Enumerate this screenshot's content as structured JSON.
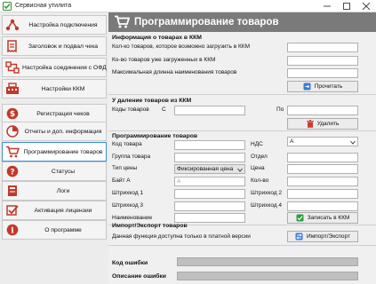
{
  "window": {
    "title": "Сервисная утилита",
    "app_icon": "green-checklist-icon"
  },
  "sidebar": {
    "items": [
      {
        "label": "Настройка подключения",
        "icon": "network-icon",
        "color": "#c0392b"
      },
      {
        "label": "Заголовок и подвал чека",
        "icon": "receipt-icon",
        "color": "#c0392b"
      },
      {
        "label": "Настройка соединения с ОФД",
        "icon": "connection-icon",
        "color": "#c0392b"
      },
      {
        "label": "Настройки ККМ",
        "icon": "register-icon",
        "color": "#c0392b"
      },
      {
        "label": "Регистрация чеков",
        "icon": "dollar-icon",
        "color": "#c0392b"
      },
      {
        "label": "Отчеты и доп. информация",
        "icon": "pie-chart-icon",
        "color": "#c0392b"
      },
      {
        "label": "Программирование товаров",
        "icon": "cart-icon",
        "color": "#c0392b",
        "active": true
      },
      {
        "label": "Статусы",
        "icon": "question-icon",
        "color": "#c0392b"
      },
      {
        "label": "Логи",
        "icon": "log-book-icon",
        "color": "#c0392b"
      },
      {
        "label": "Активация лицензии",
        "icon": "checkbox-icon",
        "color": "#c0392b"
      },
      {
        "label": "О программе",
        "icon": "info-icon",
        "color": "#c0392b"
      }
    ]
  },
  "header": {
    "title": "Программирование товаров",
    "icon": "cart-icon"
  },
  "kkm_info": {
    "section_title": "Информация о товарах в ККМ",
    "can_load_label": "Кол-ко товаров, которое возможно загрузить в ККМ",
    "loaded_label": "Ко-во товаров уже загруженных в ККМ",
    "max_name_label": "Максимальная длинна наименования товаров",
    "read_button": "Прочитать"
  },
  "delete_section": {
    "section_title": "У даление товаров из ККМ",
    "codes_label": "Коды товаров",
    "from_label": "С",
    "to_label": "По",
    "delete_button": "Удалить"
  },
  "program_section": {
    "section_title": "Программирование товаров",
    "code_label": "Код товара",
    "group_label": "Группа товара",
    "price_type_label": "Тип цены",
    "price_type_value": "Фиксированная цена",
    "byte_label": "Байт А",
    "byte_placeholder": "А",
    "barcode1_label": "Штрихкод 1",
    "barcode3_label": "Штрихкод 3",
    "name_label": "Наименование",
    "vat_label": "НДС",
    "vat_value": "А",
    "dept_label": "Отдел",
    "price_label": "Цена",
    "qty_label": "Кол-во",
    "barcode2_label": "Штрихкод 2",
    "barcode4_label": "Штрихкод 4",
    "write_button": "Записать в ККМ"
  },
  "import_export": {
    "section_title": "Импорт/Экспорт товаров",
    "note": "Данная функция доступна только в платной версии",
    "button": "Импорт/Экспорт"
  },
  "errors": {
    "code_label": "Код ошибки",
    "desc_label": "Описание ошибки"
  },
  "colors": {
    "accent_red": "#c0392b",
    "header_grey": "#7a7a7a",
    "active_border": "#3c8fd6",
    "write_green": "#2e9e3e"
  }
}
